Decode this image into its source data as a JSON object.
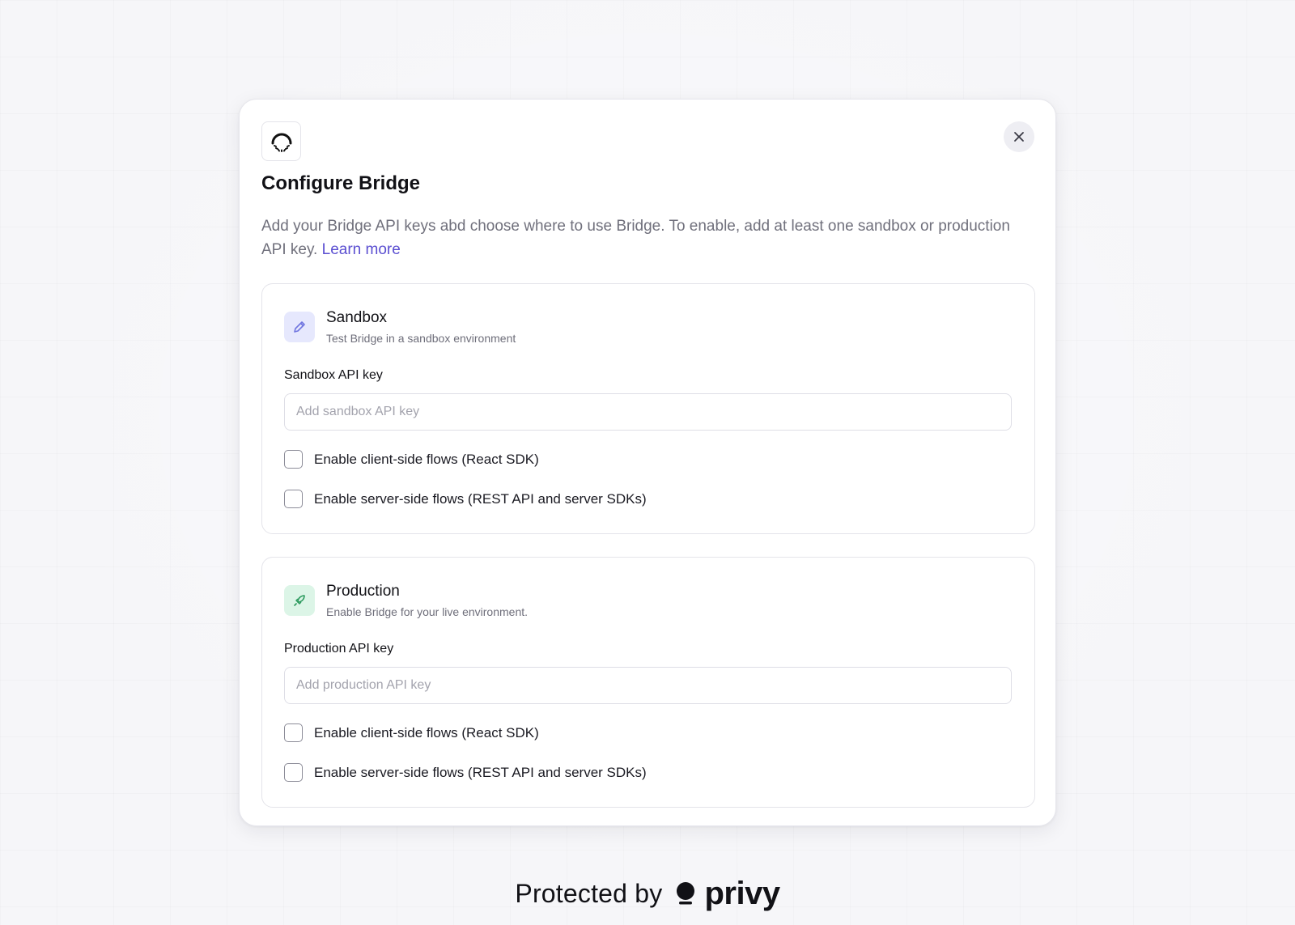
{
  "modal": {
    "title": "Configure Bridge",
    "description": "Add your Bridge API keys abd choose where to use Bridge. To enable, add at least one sandbox or production API key.",
    "learn_more_label": "Learn more",
    "app_logo_icon": "bridge-logo-icon",
    "close_icon": "close-icon"
  },
  "sandbox": {
    "icon": "pencil-icon",
    "title": "Sandbox",
    "subtitle": "Test Bridge in a sandbox environment",
    "field_label": "Sandbox API key",
    "input_value": "",
    "input_placeholder": "Add sandbox API key",
    "client_checkbox_label": "Enable client-side flows (React SDK)",
    "client_checked": false,
    "server_checkbox_label": "Enable server-side flows (REST API and server SDKs)",
    "server_checked": false
  },
  "production": {
    "icon": "rocket-icon",
    "title": "Production",
    "subtitle": "Enable Bridge for your live environment.",
    "field_label": "Production API key",
    "input_value": "",
    "input_placeholder": "Add production API key",
    "client_checkbox_label": "Enable client-side flows (React SDK)",
    "client_checked": false,
    "server_checkbox_label": "Enable server-side flows (REST API and server SDKs)",
    "server_checked": false
  },
  "footer": {
    "protected_by": "Protected by",
    "brand": "privy"
  },
  "colors": {
    "link": "#5b4fd1",
    "sandbox_icon_bg": "#e6e8fd",
    "production_icon_bg": "#dcf5e7"
  }
}
